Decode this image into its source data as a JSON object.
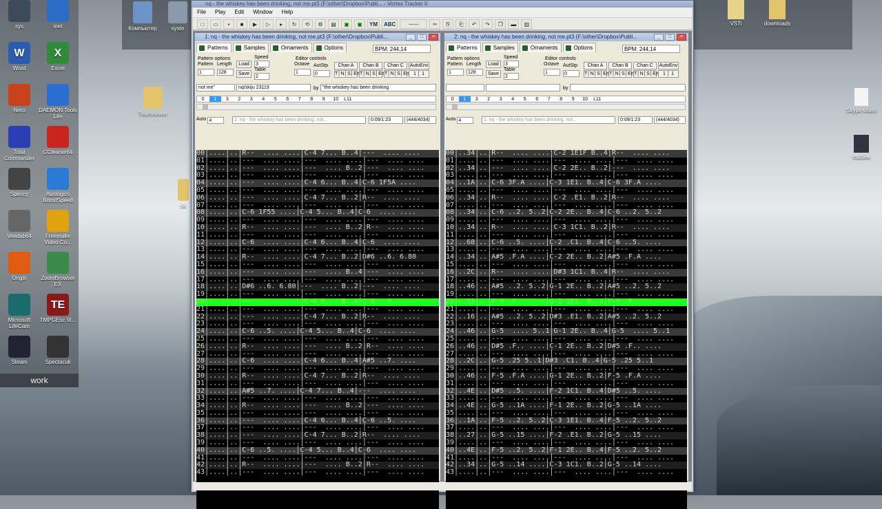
{
  "desktop": {
    "dock_label": "work",
    "left_icons": [
      {
        "label": "sys",
        "color": "#3d4a5a"
      },
      {
        "label": "inet",
        "color": "#2b6cc4"
      },
      {
        "label": "Word",
        "color": "#2a5db0",
        "glyph": "W"
      },
      {
        "label": "Excel",
        "color": "#2f8a3a",
        "glyph": "X"
      },
      {
        "label": "Nero",
        "color": "#c8421c"
      },
      {
        "label": "DAEMON Tools Lite",
        "color": "#2a6fd0"
      },
      {
        "label": "Total Commander",
        "color": "#2b3fb5"
      },
      {
        "label": "CCleaner64",
        "color": "#c9261f"
      },
      {
        "label": "Speccy",
        "color": "#444"
      },
      {
        "label": "Auslogics BoostSpeed",
        "color": "#2b7bd4"
      },
      {
        "label": "Veedub64",
        "color": "#666"
      },
      {
        "label": "Freemake Video Co...",
        "color": "#e0a20f"
      },
      {
        "label": "Origin",
        "color": "#e05a12"
      },
      {
        "label": "ZoomBrowser EX",
        "color": "#3a8a4a"
      },
      {
        "label": "Microsoft LifeCam",
        "color": "#1a6b6b"
      },
      {
        "label": "TMPGEnc Vi...",
        "color": "#8a1a1a",
        "glyph": "TE"
      },
      {
        "label": "Steam",
        "color": "#223"
      },
      {
        "label": "Spectaculi",
        "color": "#333"
      }
    ],
    "top_icons": [
      {
        "label": "Компьютер"
      },
      {
        "label": "syste"
      },
      {
        "label": "Teamviewer"
      },
      {
        "label": "sk"
      }
    ],
    "right_icons": [
      {
        "label": "VSTi"
      },
      {
        "label": "downloads"
      },
      {
        "label": "Skype video"
      },
      {
        "label": "mafilee"
      }
    ]
  },
  "app": {
    "title": "nq - the whiskey has been drinking, not me.pt3 (F:\\other\\Dropbox\\Publi... - Vortex Tracker II",
    "menu": [
      "File",
      "Play",
      "Edit",
      "Window",
      "Help"
    ],
    "toolbar_text": [
      "YM",
      "ABC"
    ]
  },
  "windows": [
    {
      "title": "1: nq - the whiskey has been drinking, not me.pt3 (F:\\other\\Dropbox\\Publi...",
      "tabs": [
        "Patterns",
        "Samples",
        "Ornaments",
        "Options"
      ],
      "bpm": "BPM: 244,14",
      "pattern_options": "Pattern options",
      "pattern_lbl": "Pattern",
      "length_lbl": "Length",
      "pattern": "1",
      "length": "128",
      "speed_lbl": "Speed",
      "speed": "3",
      "table_lbl": "Table",
      "table": "2",
      "load": "Load",
      "save": "Save",
      "editor_controls": "Editor controls",
      "octave_lbl": "Octave",
      "octave": "1",
      "autostep_lbl": "AutStp",
      "autostep": "0",
      "chan_a": "Chan A",
      "chan_b": "Chan B",
      "chan_c": "Chan C",
      "autoenv": "AutoEnv",
      "chan_flags": "T│N│S│En",
      "autoenv_val": "1 │ 1",
      "title_field": "not me\"",
      "author_field": "nq/skiju  23119",
      "by_lbl": "by",
      "by_field": "\"the whiskey has been drinking",
      "positions": [
        "0",
        "1",
        "3",
        "2",
        "3",
        "4",
        "5",
        "6",
        "7",
        "8",
        "9",
        "10",
        "L11"
      ],
      "auto_lbl": "Auto",
      "auto_val": "4",
      "status_text": "2: nq - the whiskey has been drinking, not...",
      "time": "0:09/1:23",
      "pos_info": "(444/4034)"
    },
    {
      "title": "2: nq - the whiskey has been drinking, not me.pt3 (F:\\other\\Dropbox\\Publi...",
      "tabs": [
        "Patterns",
        "Samples",
        "Ornaments",
        "Options"
      ],
      "bpm": "BPM: 244,14",
      "pattern_options": "Pattern options",
      "pattern_lbl": "Pattern",
      "length_lbl": "Length",
      "pattern": "1",
      "length": "128",
      "speed_lbl": "Speed",
      "speed": "3",
      "table_lbl": "Table",
      "table": "2",
      "load": "Load",
      "save": "Save",
      "editor_controls": "Editor controls",
      "octave_lbl": "Octave",
      "octave": "1",
      "autostep_lbl": "AutStp",
      "autostep": "0",
      "chan_a": "Chan A",
      "chan_b": "Chan B",
      "chan_c": "Chan C",
      "autoenv": "AutoEnv",
      "chan_flags": "T│N│S│En",
      "autoenv_val": "1 │ 1",
      "title_field": "",
      "author_field": "",
      "by_lbl": "by",
      "by_field": "",
      "positions": [
        "0",
        "1",
        "3",
        "2",
        "3",
        "4",
        "5",
        "6",
        "7",
        "8",
        "9",
        "10",
        "L11"
      ],
      "auto_lbl": "Auto",
      "auto_val": "4",
      "status_text": "1: nq - the whiskey has been drinking, not...",
      "time": "0:09/1:23",
      "pos_info": "(444/4034)"
    }
  ],
  "pattern_left": [
    "00│....│..│R--  .... ....│C-4 7... B..4│---  .... ....",
    "01│....│..│---  .... ....│---  .... ....│---  .... ....",
    "02│....│..│---  .... ....│---  .... B..2│---  .... ....",
    "03│....│..│---  .... ....│---  .... ....│---  .... ....",
    "04│....│..│---  .... ....│C-4 6... B..4│C-6 1F5A ....",
    "05│....│..│---  .... ....│---  .... ....│---  .... ....",
    "06│....│..│---  .... ....│C-4 7... B..2│R--  .... ....",
    "07│....│..│---  .... ....│---  .... ....│---  .... ....",
    "08│....│..│C-6 1F55 ....│C-4 5... B..4│C-6  .... ....",
    "09│....│..│---  .... ....│---  .... ....│---  .... ....",
    "10│....│..│R--  .... ....│---  .... B..2│R--  .... ....",
    "11│....│..│---  .... ....│---  .... ....│---  .... ....",
    "12│....│..│C-6  .... ....│C-4 6... B..4│C-6  .... ....",
    "13│....│..│---  .... ....│---  .... ....│---  .... ....",
    "14│....│..│R--  .... ....│C-4 7... B..2│D#6 ..6. 6.80",
    "15│....│..│---  .... ....│---  .... ....│---  .... ....",
    "16│....│..│---  .... ....│---  .... B..4│---  .... ....",
    "17│....│..│---  .... ....│---  .... ....│---  .... ....",
    "18│....│..│D#6 ..6. 6.80│---  .... B..2│---  .... ....",
    "19│....│..│---  .... ....│---  .... ....│---  .... ....",
    "20│....│..│---  .... ....│C-4 6... B..4│C-6 ..5. ....",
    "21│....│..│---  .... ....│---  .... ....│---  .... ....",
    "22│....│..│---  .... ....│C-4 7... B..2│R--  .... ....",
    "23│....│..│---  .... ....│---  .... ....│---  .... ....",
    "24│....│..│C-6 ..5. ....│C-4 5... B..4│C-6  .... ....",
    "25│....│..│---  .... ....│---  .... ....│---  .... ....",
    "26│....│..│R--  .... ....│---  .... B..2│R--  .... ....",
    "27│....│..│---  .... ....│---  .... ....│---  .... ....",
    "28│....│..│C-6  .... ....│C-4 6... B..4│A#5 ..7. ....",
    "29│....│..│---  .... ....│---  .... ....│---  .... ....",
    "30│....│..│R--  .... ....│C-4 7... B..2│R--  .... ....",
    "31│....│..│---  .... ....│---  .... ....│---  .... ....",
    "32│....│..│A#5 ..7. ....│C-4 7... B..4│---  .... ....",
    "33│....│..│---  .... ....│---  .... ....│---  .... ....",
    "34│....│..│R--  .... ....│---  .... B..2│---  .... ....",
    "35│....│..│---  .... ....│---  .... ....│---  .... ....",
    "36│....│..│---  .... ....│C-4 6... B..4│C-6 ..5. ....",
    "37│....│..│---  .... ....│---  .... ....│---  .... ....",
    "38│....│..│---  .... ....│C-4 7... B..2│R--  .... ....",
    "39│....│..│---  .... ....│---  .... ....│---  .... ....",
    "40│....│..│C-6 ..5. ....│C-4 5... B..4│C-6  .... ....",
    "41│....│..│---  .... ....│---  .... ....│---  .... ....",
    "42│....│..│R--  .... ....│---  .... B..2│R--  .... ....",
    "43│....│..│---  .... ....│---  .... ....│---  .... ...."
  ],
  "pattern_right": [
    "00│..34│..│R--  .... ....│C-2 1E1F B..4│R--  .... ....",
    "01│....│..│---  .... ....│---  .... ....│---  .... ....",
    "02│..34│..│---  .... ....│C-2 2E.. B..2│---  .... ....",
    "03│....│..│---  .... ....│---  .... ....│---  .... ....",
    "04│..1A│..│C-6 3F.A ....│C-3 1E1. B..4│C-6 3F.A ....",
    "05│....│..│---  .... ....│---  .... ....│---  .... ....",
    "06│..34│..│R--  .... ....│C-2 .E1. B..2│R--  .... ....",
    "07│....│..│---  .... ....│---  .... ....│---  .... ....",
    "08│..34│..│C-6 ..2. 5..2│C-2 2E.. B..4│C-6 ..2. 5..2",
    "09│....│..│---  .... ....│---  .... ....│---  .... ....",
    "10│..34│..│R--  .... ....│C-3 1C1. B..2│R--  .... ....",
    "11│....│..│---  .... ....│---  .... ....│---  .... ....",
    "12│..68│..│C-6 ..5. ....│C-2 .C1. B..4│C-6 ..5. ....",
    "13│....│..│---  .... ....│---  .... ....│---  .... ....",
    "14│..34│..│A#5 .F.A ....│C-2 2E.. B..2│A#5 .F.A ....",
    "15│....│..│---  .... ....│---  .... ....│---  .... ....",
    "16│..2C│..│R--  .... ....│D#3 1C1. B..4│R--  .... ....",
    "17│....│..│---  .... ....│---  .... ....│---  .... ....",
    "18│..46│..│A#5 ..2. 5..2│G-1 2E.. B..2│A#5 ..2. 5..2",
    "19│....│..│---  .... ....│---  .... ....│---  .... ....",
    "20│..23│..│F-5 .F.. ....│G-2 1E1. B..4│F-5 .F.. ....",
    "21│....│..│---  .... ....│---  .... ....│---  .... ....",
    "22│..16│..│A#5 ..2. 5..2│D#3 .E1. B..2│A#5 ..2. 5..2",
    "23│....│..│---  .... ....│---  .... ....│---  .... ....",
    "24│..46│..│G-5  .... 5..1│G-1 2E.. B..4│G-5  .... 5..1",
    "25│....│..│---  .... ....│---  .... ....│---  .... ....",
    "26│..46│..│D#5 .F.. ....│C-1 2E.. B..2│D#5 .F.. ....",
    "27│....│..│---  .... ....│---  .... ....│---  .... ....",
    "28│..2C│..│G-5 .25 5..1│D#3 .C1. B..4│G-5 .25 5..1",
    "29│....│..│---  .... ....│---  .... ....│---  .... ....",
    "30│..46│..│F-5 .F.A ....│G-1 2E.. B..2│F-5 .F.A ....",
    "31│....│..│---  .... ....│---  .... ....│---  .... ....",
    "32│..4E│..│D#5 ..5. ....│F-2 1C1. B..4│D#5 ..5. ....",
    "33│....│..│---  .... ....│---  .... ....│---  .... ....",
    "34│..4E│..│G-5 ..1A ....│F-1 2E.. B..2│G-5 ..1A ....",
    "35│....│..│---  .... ....│---  .... ....│---  .... ....",
    "36│..1A│..│F-5 ..2. 5..2│C-3 1E1. B..4│F-5 ..2. 5..2",
    "37│....│..│---  .... ....│---  .... ....│---  .... ....",
    "38│..27│..│G-5 ..15 ....│F-2 .E1. B..2│G-5 ..15 ....",
    "39│....│..│---  .... ....│---  .... ....│---  .... ....",
    "40│..4E│..│F-5 ..2. 5..2│F-1 2E.. B..4│F-5 ..2. 5..2",
    "41│....│..│---  .... ....│---  .... ....│---  .... ....",
    "42│..34│..│G-5 ..14 ....│C-3 1C1. B..2│G-5 ..14 ....",
    "43│....│..│---  .... ....│---  .... ....│---  .... ...."
  ],
  "current_row": 20,
  "colors": {
    "highlight": "#1cff1c",
    "grid_bg": "#000000",
    "grid_text": "#d8d8d8"
  }
}
